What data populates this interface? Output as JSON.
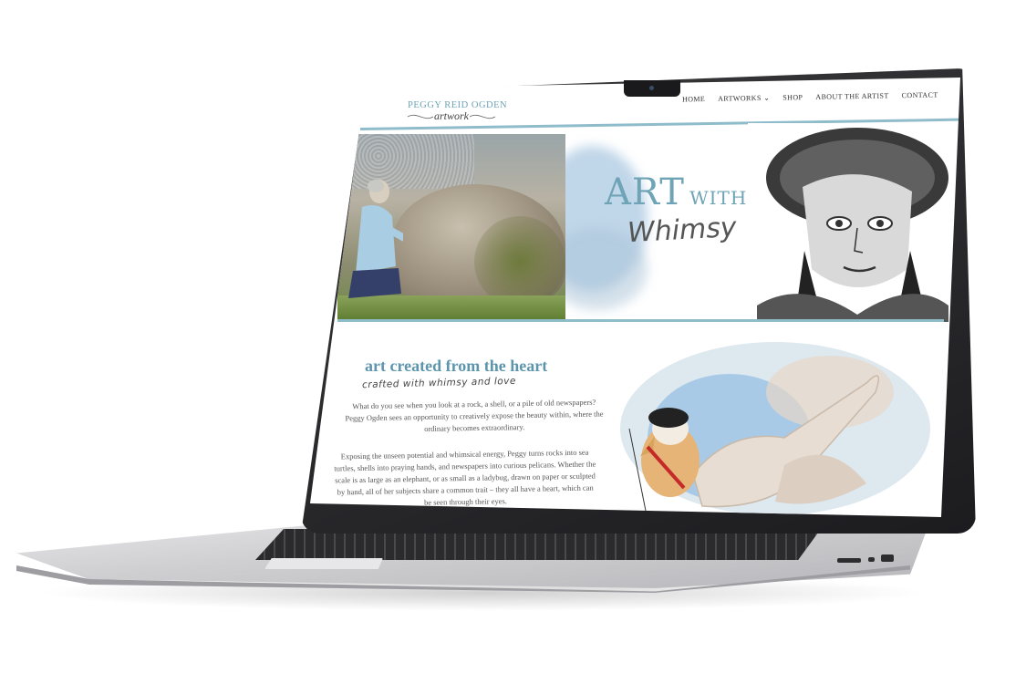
{
  "site": {
    "logo_name": "PEGGY REID OGDEN",
    "logo_sub": "artwork"
  },
  "nav": {
    "items": [
      {
        "label": "HOME"
      },
      {
        "label": "ARTWORKS ⌄"
      },
      {
        "label": "SHOP"
      },
      {
        "label": "ABOUT THE ARTIST"
      },
      {
        "label": "CONTACT"
      }
    ]
  },
  "hero": {
    "title_big": "ART",
    "title_small": "WITH",
    "script": "Whimsy"
  },
  "content": {
    "title": "art created from the heart",
    "subtitle": "crafted with whimsy and love",
    "para1": "What do you see when you look at a rock, a shell, or a pile of old newspapers? Peggy Ogden sees an opportunity to creatively expose the beauty within, where the ordinary becomes extraordinary.",
    "para2": "Exposing the unseen potential and whimsical energy, Peggy turns rocks into sea turtles, shells into praying hands, and newspapers into curious pelicans. Whether the scale is as large as an elephant, or as small as a ladybug, drawn on paper or sculpted by hand, all of her subjects share a common trait – they all have a heart, which can be seen through their eyes."
  },
  "colors": {
    "accent": "#6fa3b6",
    "rule": "#8fbccb"
  }
}
